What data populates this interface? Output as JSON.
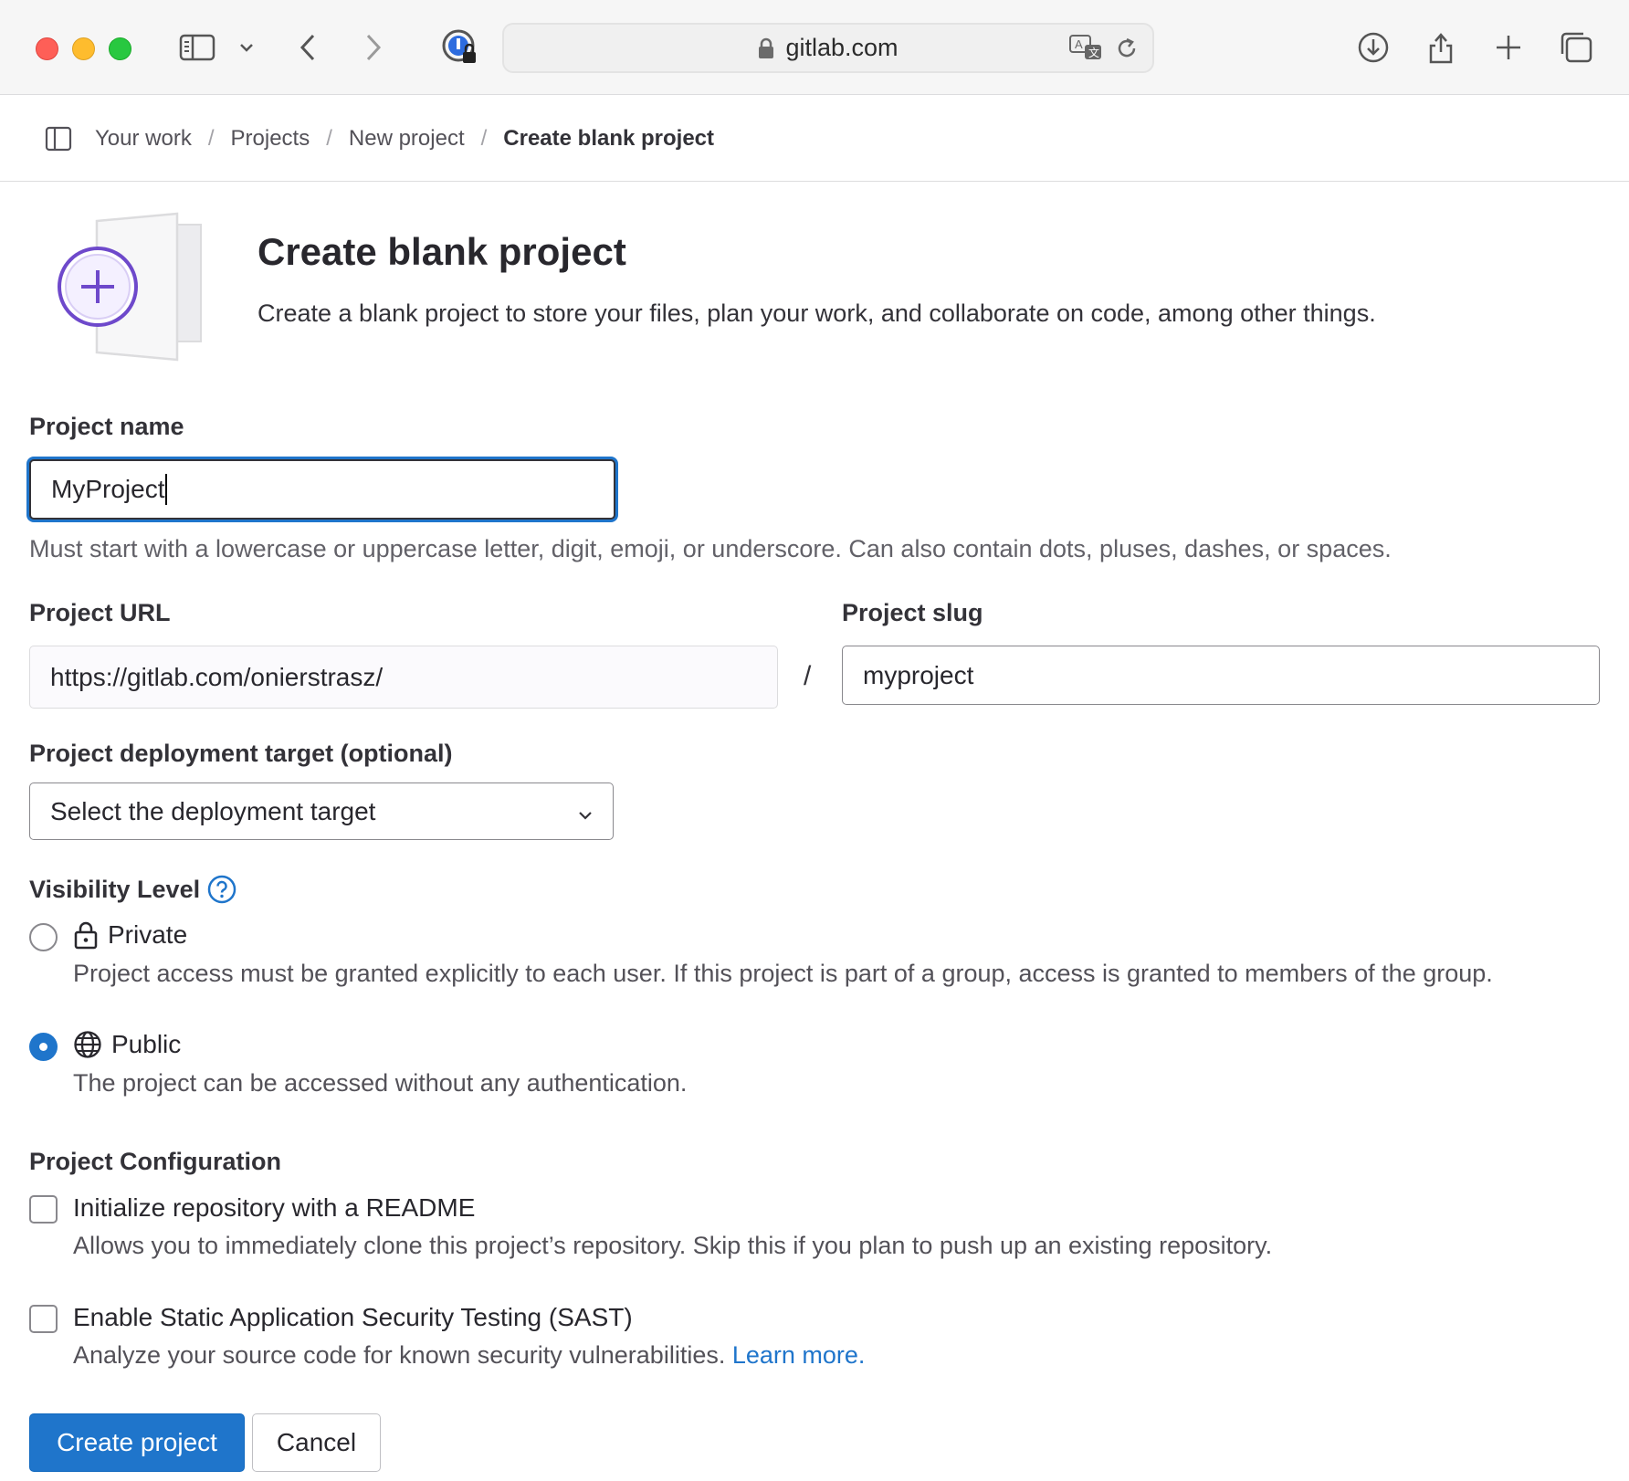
{
  "browser": {
    "url": "gitlab.com",
    "icons": [
      "sidebar-icon",
      "chevron-down-icon",
      "back-icon",
      "forward-icon",
      "password-icon",
      "lock-icon",
      "translate-icon",
      "reload-icon",
      "download-icon",
      "share-icon",
      "new-tab-icon",
      "tabs-overview-icon"
    ]
  },
  "breadcrumb": {
    "items": [
      "Your work",
      "Projects",
      "New project"
    ],
    "current": "Create blank project",
    "separator": "/"
  },
  "header": {
    "title": "Create blank project",
    "description": "Create a blank project to store your files, plan your work, and collaborate on code, among other things."
  },
  "form": {
    "project_name": {
      "label": "Project name",
      "value": "MyProject",
      "help": "Must start with a lowercase or uppercase letter, digit, emoji, or underscore. Can also contain dots, pluses, dashes, or spaces."
    },
    "project_url": {
      "label": "Project URL",
      "value": "https://gitlab.com/onierstrasz/"
    },
    "url_separator": "/",
    "project_slug": {
      "label": "Project slug",
      "value": "myproject"
    },
    "deployment_target": {
      "label": "Project deployment target (optional)",
      "selected": "Select the deployment target"
    },
    "visibility": {
      "label": "Visibility Level",
      "options": [
        {
          "label": "Private",
          "icon": "lock-icon",
          "description": "Project access must be granted explicitly to each user. If this project is part of a group, access is granted to members of the group.",
          "checked": false
        },
        {
          "label": "Public",
          "icon": "earth-icon",
          "description": "The project can be accessed without any authentication.",
          "checked": true
        }
      ]
    },
    "configuration": {
      "label": "Project Configuration",
      "options": [
        {
          "label": "Initialize repository with a README",
          "description": "Allows you to immediately clone this project’s repository. Skip this if you plan to push up an existing repository.",
          "checked": false
        },
        {
          "label": "Enable Static Application Security Testing (SAST)",
          "description": "Analyze your source code for known security vulnerabilities.",
          "link": "Learn more.",
          "checked": false
        }
      ]
    },
    "submit_label": "Create project",
    "cancel_label": "Cancel"
  },
  "colors": {
    "primary": "#1f75cb",
    "illustration": "#6e49cb",
    "text": "#333238",
    "muted": "#626168"
  }
}
